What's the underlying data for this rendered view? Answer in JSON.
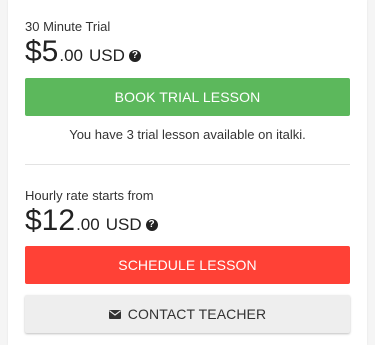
{
  "trial": {
    "label": "30 Minute Trial",
    "price_main": "$5",
    "price_cents": ".00",
    "currency": "USD",
    "book_button": "BOOK TRIAL LESSON",
    "note": "You have 3 trial lesson available on italki."
  },
  "hourly": {
    "label": "Hourly rate starts from",
    "price_main": "$12",
    "price_cents": ".00",
    "currency": "USD",
    "schedule_button": "SCHEDULE LESSON",
    "contact_button": "CONTACT TEACHER"
  },
  "icons": {
    "help": "question-circle-icon",
    "mail": "envelope-icon"
  },
  "colors": {
    "book": "#5cb85c",
    "schedule": "#ff4136",
    "contact": "#eeeeee"
  }
}
